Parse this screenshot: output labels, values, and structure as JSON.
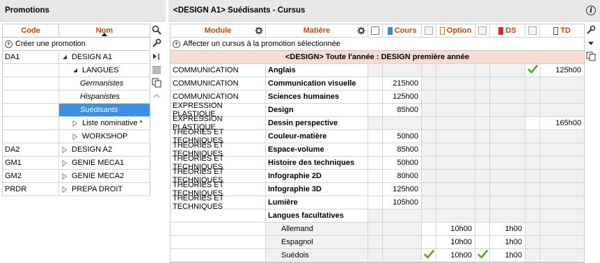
{
  "left": {
    "title": "Promotions",
    "headers": {
      "code": "Code",
      "nom": "Nom"
    },
    "create": "Créer une promotion",
    "rows": [
      {
        "code": "DA1",
        "nom": "DESIGN A1",
        "indent": 0,
        "tri": "open",
        "italic": false,
        "selected": false
      },
      {
        "code": "",
        "nom": "LANGUES",
        "indent": 1,
        "tri": "open",
        "italic": false,
        "selected": false
      },
      {
        "code": "",
        "nom": "Germanistes",
        "indent": 2,
        "tri": "",
        "italic": true,
        "selected": false
      },
      {
        "code": "",
        "nom": "Hispanistes",
        "indent": 2,
        "tri": "",
        "italic": true,
        "selected": false
      },
      {
        "code": "",
        "nom": "Suédisants",
        "indent": 2,
        "tri": "",
        "italic": true,
        "selected": true
      },
      {
        "code": "",
        "nom": "Liste nominative *",
        "indent": 1,
        "tri": "closed",
        "italic": false,
        "selected": false
      },
      {
        "code": "",
        "nom": "WORKSHOP",
        "indent": 1,
        "tri": "closed",
        "italic": false,
        "selected": false
      },
      {
        "code": "DA2",
        "nom": "DESIGN A2",
        "indent": 0,
        "tri": "closed",
        "italic": false,
        "selected": false
      },
      {
        "code": "GM1",
        "nom": "GENIE MECA1",
        "indent": 0,
        "tri": "closed",
        "italic": false,
        "selected": false
      },
      {
        "code": "GM2",
        "nom": "GENIE MECA2",
        "indent": 0,
        "tri": "closed",
        "italic": false,
        "selected": false
      },
      {
        "code": "PRDR",
        "nom": "PREPA DROIT",
        "indent": 0,
        "tri": "closed",
        "italic": false,
        "selected": false
      }
    ]
  },
  "right": {
    "title": "<DESIGN A1> Suédisants - Cursus",
    "headers": {
      "module": "Module",
      "matiere": "Matière",
      "cours": "Cours",
      "option": "Option",
      "ds": "DS",
      "td": "TD"
    },
    "colors": {
      "cours": "#2b8fd6",
      "option": "#e07b22",
      "ds": "#d42b2b",
      "td": "#777777",
      "accent": "#c3470c",
      "section_bg": "#f7dcd3",
      "selection": "#3d8ee6",
      "check": "#4ea82c"
    },
    "affect": "Affecter un cursus à la promotion sélectionnée",
    "section": "<DESIGN> Toute l'année : DESIGN première année",
    "rows": [
      {
        "module": "COMMUNICATION",
        "matiere": "Anglais",
        "cours": "",
        "option": "",
        "ds": "",
        "td": "125h00",
        "td_check": true
      },
      {
        "module": "COMMUNICATION",
        "matiere": "Communication visuelle",
        "cours": "215h00",
        "option": "",
        "ds": "",
        "td": ""
      },
      {
        "module": "COMMUNICATION",
        "matiere": "Sciences humaines",
        "cours": "125h00",
        "option": "",
        "ds": "",
        "td": ""
      },
      {
        "module": "EXPRESSION PLASTIQUE",
        "matiere": "Design",
        "cours": "85h00",
        "option": "",
        "ds": "",
        "td": ""
      },
      {
        "module": "EXPRESSION PLASTIQUE",
        "matiere": "Dessin perspective",
        "cours": "",
        "option": "",
        "ds": "",
        "td": "165h00"
      },
      {
        "module": "THÉORIES ET TECHNIQUES",
        "matiere": "Couleur-matière",
        "cours": "50h00",
        "option": "",
        "ds": "",
        "td": ""
      },
      {
        "module": "THÉORIES ET TECHNIQUES",
        "matiere": "Espace-volume",
        "cours": "85h00",
        "option": "",
        "ds": "",
        "td": ""
      },
      {
        "module": "THÉORIES ET TECHNIQUES",
        "matiere": "Histoire des techniques",
        "cours": "50h00",
        "option": "",
        "ds": "",
        "td": ""
      },
      {
        "module": "THÉORIES ET TECHNIQUES",
        "matiere": "Infographie 2D",
        "cours": "80h00",
        "option": "",
        "ds": "",
        "td": ""
      },
      {
        "module": "THÉORIES ET TECHNIQUES",
        "matiere": "Infographie 3D",
        "cours": "125h00",
        "option": "",
        "ds": "",
        "td": ""
      },
      {
        "module": "THÉORIES ET TECHNIQUES",
        "matiere": "Lumière",
        "cours": "105h00",
        "option": "",
        "ds": "",
        "td": ""
      }
    ],
    "optional_group": "Langues facultatives",
    "optional_rows": [
      {
        "matiere": "Allemand",
        "option": "10h00",
        "ds": "1h00",
        "checks": false
      },
      {
        "matiere": "Espagnol",
        "option": "10h00",
        "ds": "1h00",
        "checks": false
      },
      {
        "matiere": "Suédois",
        "option": "10h00",
        "ds": "1h00",
        "checks": true
      }
    ]
  }
}
